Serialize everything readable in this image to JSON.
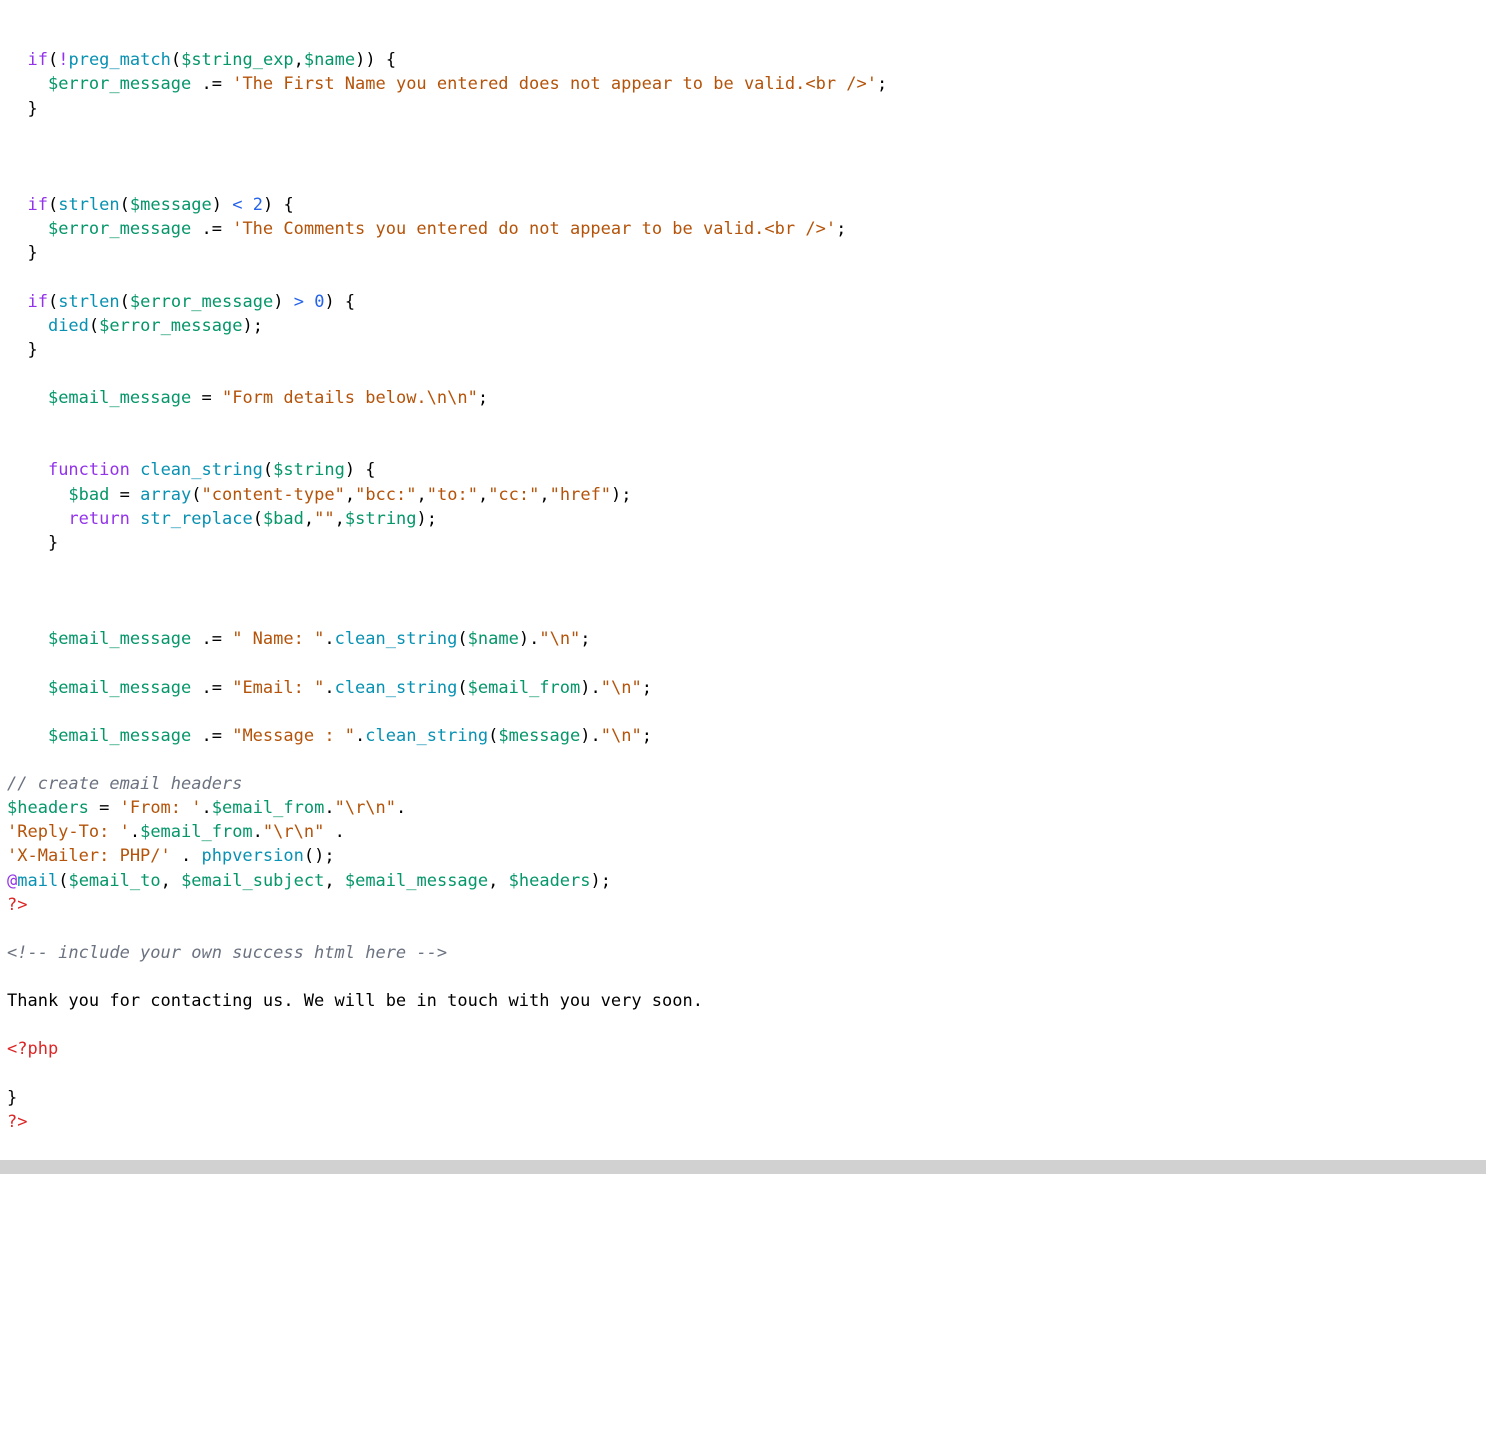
{
  "code": {
    "lines": [
      [
        {
          "t": "  ",
          "c": ""
        },
        {
          "t": "if",
          "c": "kw"
        },
        {
          "t": "(",
          "c": "brc"
        },
        {
          "t": "!",
          "c": "kw"
        },
        {
          "t": "preg_match",
          "c": "fn"
        },
        {
          "t": "(",
          "c": "brc"
        },
        {
          "t": "$string_exp",
          "c": "var"
        },
        {
          "t": ",",
          "c": ""
        },
        {
          "t": "$name",
          "c": "var"
        },
        {
          "t": ")) {",
          "c": "brc"
        }
      ],
      [
        {
          "t": "    ",
          "c": ""
        },
        {
          "t": "$error_message",
          "c": "var"
        },
        {
          "t": " ",
          "c": ""
        },
        {
          "t": ".=",
          "c": ""
        },
        {
          "t": " ",
          "c": ""
        },
        {
          "t": "'The First Name you entered does not appear to be valid.<br />'",
          "c": "str"
        },
        {
          "t": ";",
          "c": ""
        }
      ],
      [
        {
          "t": "  }",
          "c": "brc"
        }
      ],
      [
        {
          "t": "",
          "c": ""
        }
      ],
      [
        {
          "t": "",
          "c": ""
        }
      ],
      [
        {
          "t": "",
          "c": ""
        }
      ],
      [
        {
          "t": "  ",
          "c": ""
        },
        {
          "t": "if",
          "c": "kw"
        },
        {
          "t": "(",
          "c": "brc"
        },
        {
          "t": "strlen",
          "c": "fn"
        },
        {
          "t": "(",
          "c": "brc"
        },
        {
          "t": "$message",
          "c": "var"
        },
        {
          "t": ")",
          "c": "brc"
        },
        {
          "t": " ",
          "c": ""
        },
        {
          "t": "<",
          "c": "op"
        },
        {
          "t": " ",
          "c": ""
        },
        {
          "t": "2",
          "c": "num"
        },
        {
          "t": ") {",
          "c": "brc"
        }
      ],
      [
        {
          "t": "    ",
          "c": ""
        },
        {
          "t": "$error_message",
          "c": "var"
        },
        {
          "t": " ",
          "c": ""
        },
        {
          "t": ".=",
          "c": ""
        },
        {
          "t": " ",
          "c": ""
        },
        {
          "t": "'The Comments you entered do not appear to be valid.<br />'",
          "c": "str"
        },
        {
          "t": ";",
          "c": ""
        }
      ],
      [
        {
          "t": "  }",
          "c": "brc"
        }
      ],
      [
        {
          "t": "",
          "c": ""
        }
      ],
      [
        {
          "t": "  ",
          "c": ""
        },
        {
          "t": "if",
          "c": "kw"
        },
        {
          "t": "(",
          "c": "brc"
        },
        {
          "t": "strlen",
          "c": "fn"
        },
        {
          "t": "(",
          "c": "brc"
        },
        {
          "t": "$error_message",
          "c": "var"
        },
        {
          "t": ")",
          "c": "brc"
        },
        {
          "t": " ",
          "c": ""
        },
        {
          "t": ">",
          "c": "op"
        },
        {
          "t": " ",
          "c": ""
        },
        {
          "t": "0",
          "c": "num"
        },
        {
          "t": ") {",
          "c": "brc"
        }
      ],
      [
        {
          "t": "    ",
          "c": ""
        },
        {
          "t": "died",
          "c": "fn"
        },
        {
          "t": "(",
          "c": "brc"
        },
        {
          "t": "$error_message",
          "c": "var"
        },
        {
          "t": ")",
          "c": "brc"
        },
        {
          "t": ";",
          "c": ""
        }
      ],
      [
        {
          "t": "  }",
          "c": "brc"
        }
      ],
      [
        {
          "t": "",
          "c": ""
        }
      ],
      [
        {
          "t": "    ",
          "c": ""
        },
        {
          "t": "$email_message",
          "c": "var"
        },
        {
          "t": " ",
          "c": ""
        },
        {
          "t": "=",
          "c": ""
        },
        {
          "t": " ",
          "c": ""
        },
        {
          "t": "\"Form details below.\\n\\n\"",
          "c": "str"
        },
        {
          "t": ";",
          "c": ""
        }
      ],
      [
        {
          "t": "",
          "c": ""
        }
      ],
      [
        {
          "t": "",
          "c": ""
        }
      ],
      [
        {
          "t": "    ",
          "c": ""
        },
        {
          "t": "function",
          "c": "kw"
        },
        {
          "t": " ",
          "c": ""
        },
        {
          "t": "clean_string",
          "c": "fn"
        },
        {
          "t": "(",
          "c": "brc"
        },
        {
          "t": "$string",
          "c": "var"
        },
        {
          "t": ") {",
          "c": "brc"
        }
      ],
      [
        {
          "t": "      ",
          "c": ""
        },
        {
          "t": "$bad",
          "c": "var"
        },
        {
          "t": " ",
          "c": ""
        },
        {
          "t": "=",
          "c": ""
        },
        {
          "t": " ",
          "c": ""
        },
        {
          "t": "array",
          "c": "fn"
        },
        {
          "t": "(",
          "c": "brc"
        },
        {
          "t": "\"content-type\"",
          "c": "str"
        },
        {
          "t": ",",
          "c": ""
        },
        {
          "t": "\"bcc:\"",
          "c": "str"
        },
        {
          "t": ",",
          "c": ""
        },
        {
          "t": "\"to:\"",
          "c": "str"
        },
        {
          "t": ",",
          "c": ""
        },
        {
          "t": "\"cc:\"",
          "c": "str"
        },
        {
          "t": ",",
          "c": ""
        },
        {
          "t": "\"href\"",
          "c": "str"
        },
        {
          "t": ")",
          "c": "brc"
        },
        {
          "t": ";",
          "c": ""
        }
      ],
      [
        {
          "t": "      ",
          "c": ""
        },
        {
          "t": "return",
          "c": "kw"
        },
        {
          "t": " ",
          "c": ""
        },
        {
          "t": "str_replace",
          "c": "fn"
        },
        {
          "t": "(",
          "c": "brc"
        },
        {
          "t": "$bad",
          "c": "var"
        },
        {
          "t": ",",
          "c": ""
        },
        {
          "t": "\"\"",
          "c": "str"
        },
        {
          "t": ",",
          "c": ""
        },
        {
          "t": "$string",
          "c": "var"
        },
        {
          "t": ")",
          "c": "brc"
        },
        {
          "t": ";",
          "c": ""
        }
      ],
      [
        {
          "t": "    }",
          "c": "brc"
        }
      ],
      [
        {
          "t": "",
          "c": ""
        }
      ],
      [
        {
          "t": "",
          "c": ""
        }
      ],
      [
        {
          "t": "",
          "c": ""
        }
      ],
      [
        {
          "t": "    ",
          "c": ""
        },
        {
          "t": "$email_message",
          "c": "var"
        },
        {
          "t": " ",
          "c": ""
        },
        {
          "t": ".=",
          "c": ""
        },
        {
          "t": " ",
          "c": ""
        },
        {
          "t": "\" Name: \"",
          "c": "str"
        },
        {
          "t": ".",
          "c": ""
        },
        {
          "t": "clean_string",
          "c": "fn"
        },
        {
          "t": "(",
          "c": "brc"
        },
        {
          "t": "$name",
          "c": "var"
        },
        {
          "t": ")",
          "c": "brc"
        },
        {
          "t": ".",
          "c": ""
        },
        {
          "t": "\"\\n\"",
          "c": "str"
        },
        {
          "t": ";",
          "c": ""
        }
      ],
      [
        {
          "t": "",
          "c": ""
        }
      ],
      [
        {
          "t": "    ",
          "c": ""
        },
        {
          "t": "$email_message",
          "c": "var"
        },
        {
          "t": " ",
          "c": ""
        },
        {
          "t": ".=",
          "c": ""
        },
        {
          "t": " ",
          "c": ""
        },
        {
          "t": "\"Email: \"",
          "c": "str"
        },
        {
          "t": ".",
          "c": ""
        },
        {
          "t": "clean_string",
          "c": "fn"
        },
        {
          "t": "(",
          "c": "brc"
        },
        {
          "t": "$email_from",
          "c": "var"
        },
        {
          "t": ")",
          "c": "brc"
        },
        {
          "t": ".",
          "c": ""
        },
        {
          "t": "\"\\n\"",
          "c": "str"
        },
        {
          "t": ";",
          "c": ""
        }
      ],
      [
        {
          "t": "",
          "c": ""
        }
      ],
      [
        {
          "t": "    ",
          "c": ""
        },
        {
          "t": "$email_message",
          "c": "var"
        },
        {
          "t": " ",
          "c": ""
        },
        {
          "t": ".=",
          "c": ""
        },
        {
          "t": " ",
          "c": ""
        },
        {
          "t": "\"Message : \"",
          "c": "str"
        },
        {
          "t": ".",
          "c": ""
        },
        {
          "t": "clean_string",
          "c": "fn"
        },
        {
          "t": "(",
          "c": "brc"
        },
        {
          "t": "$message",
          "c": "var"
        },
        {
          "t": ")",
          "c": "brc"
        },
        {
          "t": ".",
          "c": ""
        },
        {
          "t": "\"\\n\"",
          "c": "str"
        },
        {
          "t": ";",
          "c": ""
        }
      ],
      [
        {
          "t": "",
          "c": ""
        }
      ],
      [
        {
          "t": "// create email headers",
          "c": "cmt"
        }
      ],
      [
        {
          "t": "$headers",
          "c": "var"
        },
        {
          "t": " ",
          "c": ""
        },
        {
          "t": "=",
          "c": ""
        },
        {
          "t": " ",
          "c": ""
        },
        {
          "t": "'From: '",
          "c": "str"
        },
        {
          "t": ".",
          "c": ""
        },
        {
          "t": "$email_from",
          "c": "var"
        },
        {
          "t": ".",
          "c": ""
        },
        {
          "t": "\"\\r\\n\"",
          "c": "str"
        },
        {
          "t": ".",
          "c": ""
        }
      ],
      [
        {
          "t": "'Reply-To: '",
          "c": "str"
        },
        {
          "t": ".",
          "c": ""
        },
        {
          "t": "$email_from",
          "c": "var"
        },
        {
          "t": ".",
          "c": ""
        },
        {
          "t": "\"\\r\\n\"",
          "c": "str"
        },
        {
          "t": " .",
          "c": ""
        }
      ],
      [
        {
          "t": "'X-Mailer: PHP/'",
          "c": "str"
        },
        {
          "t": " . ",
          "c": ""
        },
        {
          "t": "phpversion",
          "c": "fn"
        },
        {
          "t": "()",
          "c": "brc"
        },
        {
          "t": ";",
          "c": ""
        }
      ],
      [
        {
          "t": "@",
          "c": "kw"
        },
        {
          "t": "mail",
          "c": "fn"
        },
        {
          "t": "(",
          "c": "brc"
        },
        {
          "t": "$email_to",
          "c": "var"
        },
        {
          "t": ", ",
          "c": ""
        },
        {
          "t": "$email_subject",
          "c": "var"
        },
        {
          "t": ", ",
          "c": ""
        },
        {
          "t": "$email_message",
          "c": "var"
        },
        {
          "t": ", ",
          "c": ""
        },
        {
          "t": "$headers",
          "c": "var"
        },
        {
          "t": ")",
          "c": "brc"
        },
        {
          "t": ";",
          "c": ""
        }
      ],
      [
        {
          "t": "?>",
          "c": "php"
        }
      ],
      [
        {
          "t": "",
          "c": ""
        }
      ],
      [
        {
          "t": "<!-- include your own success html here -->",
          "c": "cmt"
        }
      ],
      [
        {
          "t": "",
          "c": ""
        }
      ],
      [
        {
          "t": "Thank you for contacting us. We will be in touch with you very soon.",
          "c": ""
        }
      ],
      [
        {
          "t": "",
          "c": ""
        }
      ],
      [
        {
          "t": "<?php",
          "c": "php"
        }
      ],
      [
        {
          "t": "",
          "c": ""
        }
      ],
      [
        {
          "t": "}",
          "c": "brc"
        }
      ],
      [
        {
          "t": "?>",
          "c": "php"
        }
      ]
    ]
  }
}
